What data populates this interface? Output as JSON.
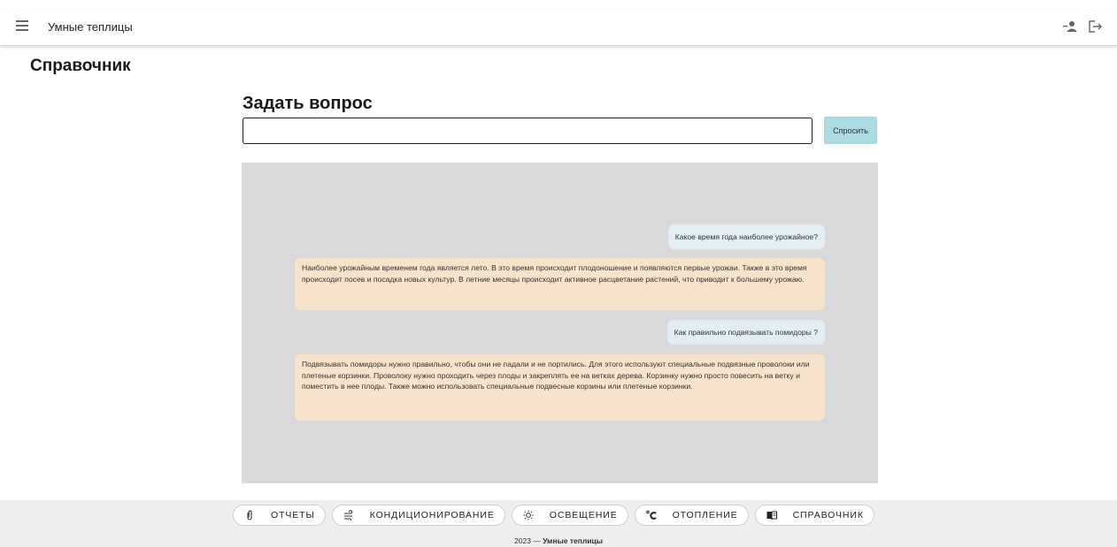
{
  "app": {
    "title": "Умные теплицы"
  },
  "page": {
    "title": "Справочник"
  },
  "ask": {
    "heading": "Задать вопрос",
    "input_value": "",
    "button_label": "Спросить"
  },
  "chat": {
    "messages": [
      {
        "role": "question",
        "text": "Какое время года наиболее урожайное?"
      },
      {
        "role": "answer",
        "text": "Наиболее урожайным временем года является лето. В это время происходит плодоношение и появляются первые урожаи. Также в это время происходит посев и посадка новых культур. В летние месяцы происходит активное расцветание растений, что приводит к большему урожаю."
      },
      {
        "role": "question",
        "text": "Как правильно подвязывать помидоры ?"
      },
      {
        "role": "answer",
        "text": "Подвязывать помидоры нужно правильно, чтобы они не падали и не портились. Для этого используют специальные подвязные проволоки или плетеные корзинки. Проволоку нужно проходить через плоды и закреплять ее на ветках дерева. Корзинку нужно просто повесить на ветку и поместить в нее плоды. Также можно использовать специальные подвесные корзины или плетеные корзинки."
      }
    ]
  },
  "nav": {
    "items": [
      {
        "label": "ОТЧЕТЫ",
        "icon": "paperclip-icon"
      },
      {
        "label": "КОНДИЦИОНИРОВАНИЕ",
        "icon": "air-flow-icon"
      },
      {
        "label": "ОСВЕЩЕНИЕ",
        "icon": "lightbulb-icon"
      },
      {
        "label": "ОТОПЛЕНИЕ",
        "icon": "celsius-icon"
      },
      {
        "label": "СПРАВОЧНИК",
        "icon": "book-icon"
      }
    ]
  },
  "footer": {
    "year": "2023 —",
    "brand": "Умные теплицы"
  },
  "colors": {
    "ask_button": "#a9dbe0",
    "question_bubble": "#e3eef4",
    "answer_bubble": "#f7e3cc",
    "chat_bg": "#d9d9d9"
  }
}
